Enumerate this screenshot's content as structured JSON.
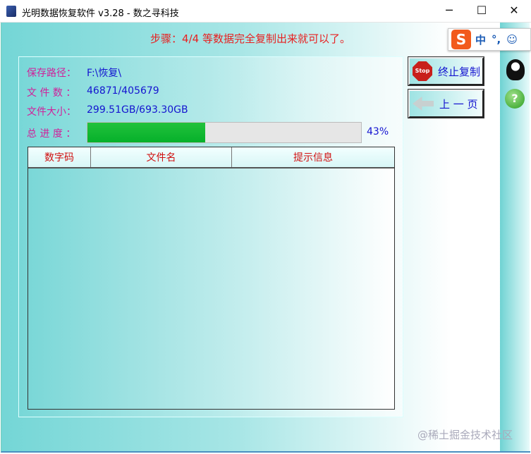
{
  "window": {
    "title": "光明数据恢复软件 v3.28 - 数之寻科技",
    "minimize": "─",
    "maximize": "☐",
    "close": "✕"
  },
  "step_text": "步骤：4/4 等数据完全复制出来就可以了。",
  "fields": {
    "save_path": {
      "label": "保存路径：",
      "value": "F:\\恢复\\"
    },
    "file_count": {
      "label": "文 件 数 ：",
      "value": "46871/405679"
    },
    "file_size": {
      "label": "文件大小：",
      "value": "299.51GB/693.30GB"
    },
    "progress": {
      "label": "总 进 度 ：",
      "value": "43%",
      "fraction": 0.43
    }
  },
  "table": {
    "columns": [
      "数字码",
      "文件名",
      "提示信息"
    ],
    "rows": []
  },
  "buttons": {
    "stop": "终止复制",
    "stop_icon_text": "Stop",
    "back": "上 一 页"
  },
  "ime": {
    "logo": "S",
    "mode": "中",
    "punct": "°,",
    "emoji": "☺"
  },
  "help_icon": "?",
  "watermark": "@稀土掘金技术社区"
}
